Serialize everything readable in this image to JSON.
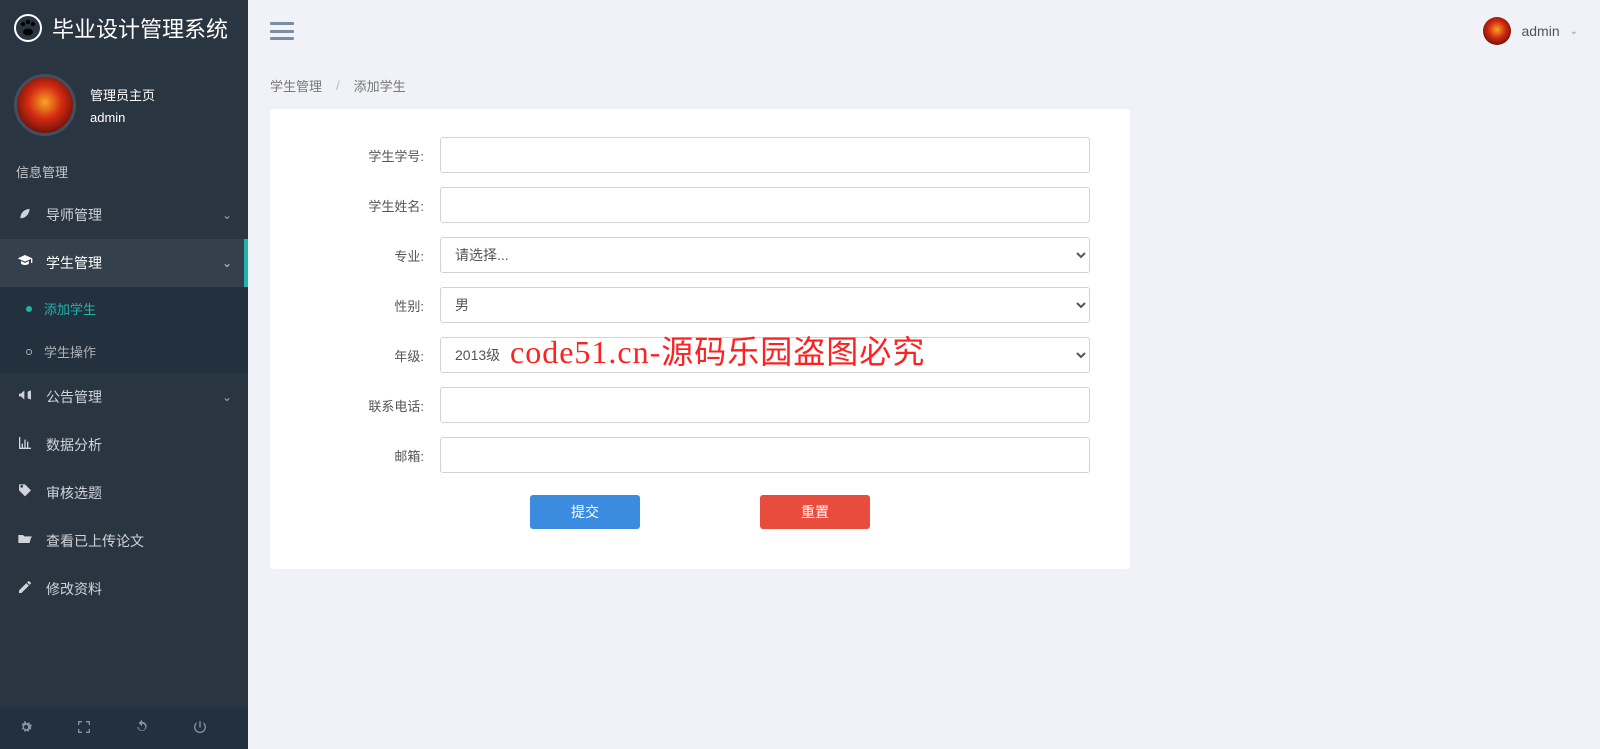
{
  "brand": {
    "title": "毕业设计管理系统"
  },
  "user": {
    "role_label": "管理员主页",
    "name": "admin"
  },
  "section_label": "信息管理",
  "sidebar": {
    "items": [
      {
        "label": "导师管理",
        "icon": "leaf",
        "expandable": true
      },
      {
        "label": "学生管理",
        "icon": "grad-cap",
        "expandable": true,
        "active": true,
        "children": [
          {
            "label": "添加学生",
            "current": true
          },
          {
            "label": "学生操作"
          }
        ]
      },
      {
        "label": "公告管理",
        "icon": "bullhorn",
        "expandable": true
      },
      {
        "label": "数据分析",
        "icon": "bar-chart"
      },
      {
        "label": "审核选题",
        "icon": "tag"
      },
      {
        "label": "查看已上传论文",
        "icon": "folder-open"
      },
      {
        "label": "修改资料",
        "icon": "edit"
      }
    ]
  },
  "topbar": {
    "user_name": "admin"
  },
  "breadcrumb": {
    "parent": "学生管理",
    "current": "添加学生"
  },
  "form": {
    "student_id_label": "学生学号:",
    "student_name_label": "学生姓名:",
    "major_label": "专业:",
    "major_placeholder": "请选择...",
    "gender_label": "性别:",
    "gender_value": "男",
    "grade_label": "年级:",
    "grade_value": "2013级",
    "phone_label": "联系电话:",
    "email_label": "邮箱:",
    "submit_label": "提交",
    "reset_label": "重置"
  },
  "watermark": "code51.cn-源码乐园盗图必究"
}
